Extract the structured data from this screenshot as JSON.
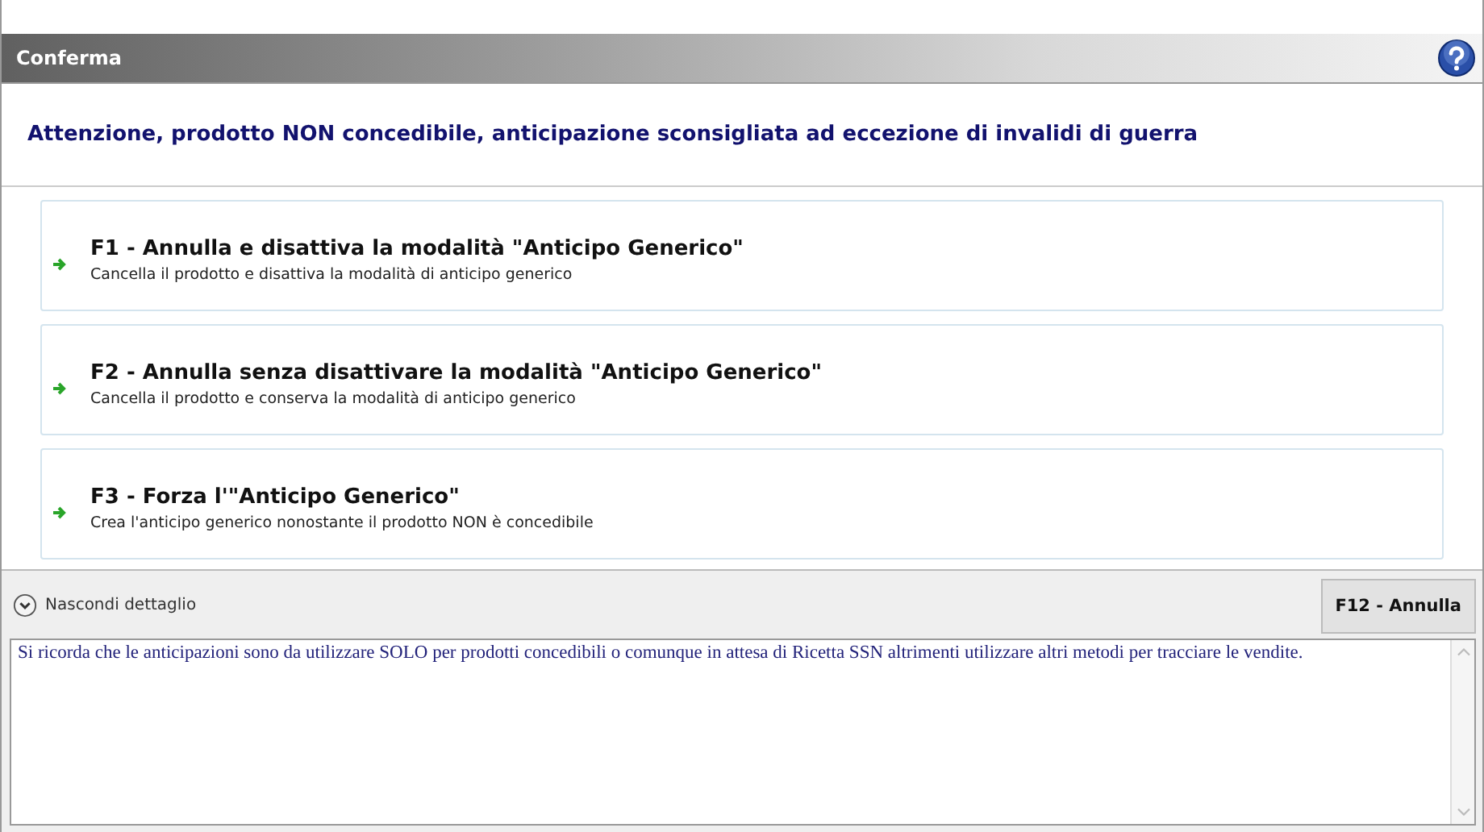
{
  "window": {
    "title": "Conferma"
  },
  "warning": "Attenzione, prodotto NON concedibile, anticipazione sconsigliata ad eccezione di invalidi di guerra",
  "options": [
    {
      "title": "F1 - Annulla e disattiva la modalità \"Anticipo Generico\"",
      "description": "Cancella il prodotto e disattiva la modalità di anticipo generico"
    },
    {
      "title": "F2 - Annulla senza disattivare la modalità \"Anticipo Generico\"",
      "description": "Cancella il prodotto e conserva la modalità di anticipo generico"
    },
    {
      "title": "F3 - Forza l'\"Anticipo Generico\"",
      "description": "Crea l'anticipo generico nonostante il prodotto NON è concedibile"
    }
  ],
  "detail_toggle": {
    "label": "Nascondi dettaglio",
    "expanded": true
  },
  "cancel_button": "F12 - Annulla",
  "detail_text": "Si ricorda che le anticipazioni sono da utilizzare SOLO per prodotti concedibili o comunque in attesa di Ricetta SSN altrimenti utilizzare altri metodi per tracciare le vendite."
}
